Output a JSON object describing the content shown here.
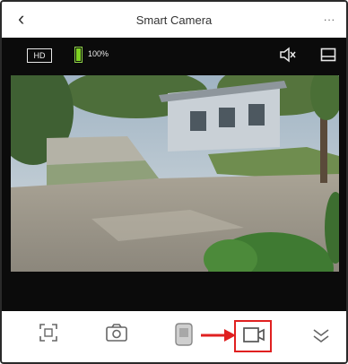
{
  "header": {
    "title": "Smart Camera",
    "more_label": "..."
  },
  "video": {
    "quality_label": "HD",
    "battery_text": "100%",
    "battery_level": 1.0
  },
  "controls": {
    "icons": [
      "screenshot-frame-icon",
      "camera-icon",
      "intercom-icon",
      "record-icon",
      "more-chevron-icon"
    ],
    "highlight_color": "#e02020"
  },
  "colors": {
    "battery": "#7ed321",
    "header_bg": "#ffffff",
    "video_bg": "#0b0b0b"
  }
}
